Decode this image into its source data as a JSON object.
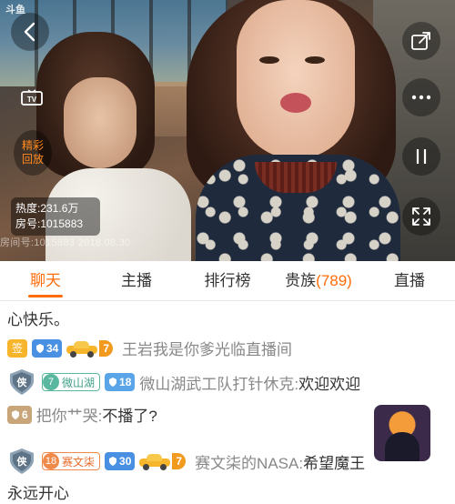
{
  "video": {
    "logo": "斗鱼",
    "replay_label_1": "精彩",
    "replay_label_2": "回放",
    "heat": "热度:231.6万",
    "room": "房号:1015883",
    "watermark": "房间号:1015883 2018.08.30",
    "icons": [
      "back-arrow-icon",
      "tv-icon",
      "share-icon",
      "more-dots-icon",
      "pause-icon",
      "fullscreen-icon"
    ]
  },
  "tabs": [
    {
      "label": "聊天",
      "active": true
    },
    {
      "label": "主播"
    },
    {
      "label": "排行榜"
    },
    {
      "label": "贵族",
      "count": "(789)"
    },
    {
      "label": "直播"
    }
  ],
  "chat": {
    "line0": "心快乐。",
    "line1": {
      "sign_badge": "签",
      "level_badge": "34",
      "car_level": "7",
      "text": "王岩我是你爹光临直播间"
    },
    "line2": {
      "fan_level": "7",
      "fan_name": "微山湖",
      "level_badge": "18",
      "name": "微山湖武工队打针休克:",
      "text": "欢迎欢迎"
    },
    "line3": {
      "level_badge": "6",
      "name": "把你艹哭:",
      "text": "不播了?"
    },
    "line4": {
      "fan_level": "18",
      "fan_name": "赛文柒",
      "level_badge": "30",
      "car_level": "7",
      "name": "赛文柒的NASA:",
      "text": "希望魔王"
    },
    "line5": "永远开心"
  },
  "colors": {
    "accent": "#ff6d0a",
    "level_blue": "#4a90e2",
    "sign_yellow": "#f7b52c"
  }
}
